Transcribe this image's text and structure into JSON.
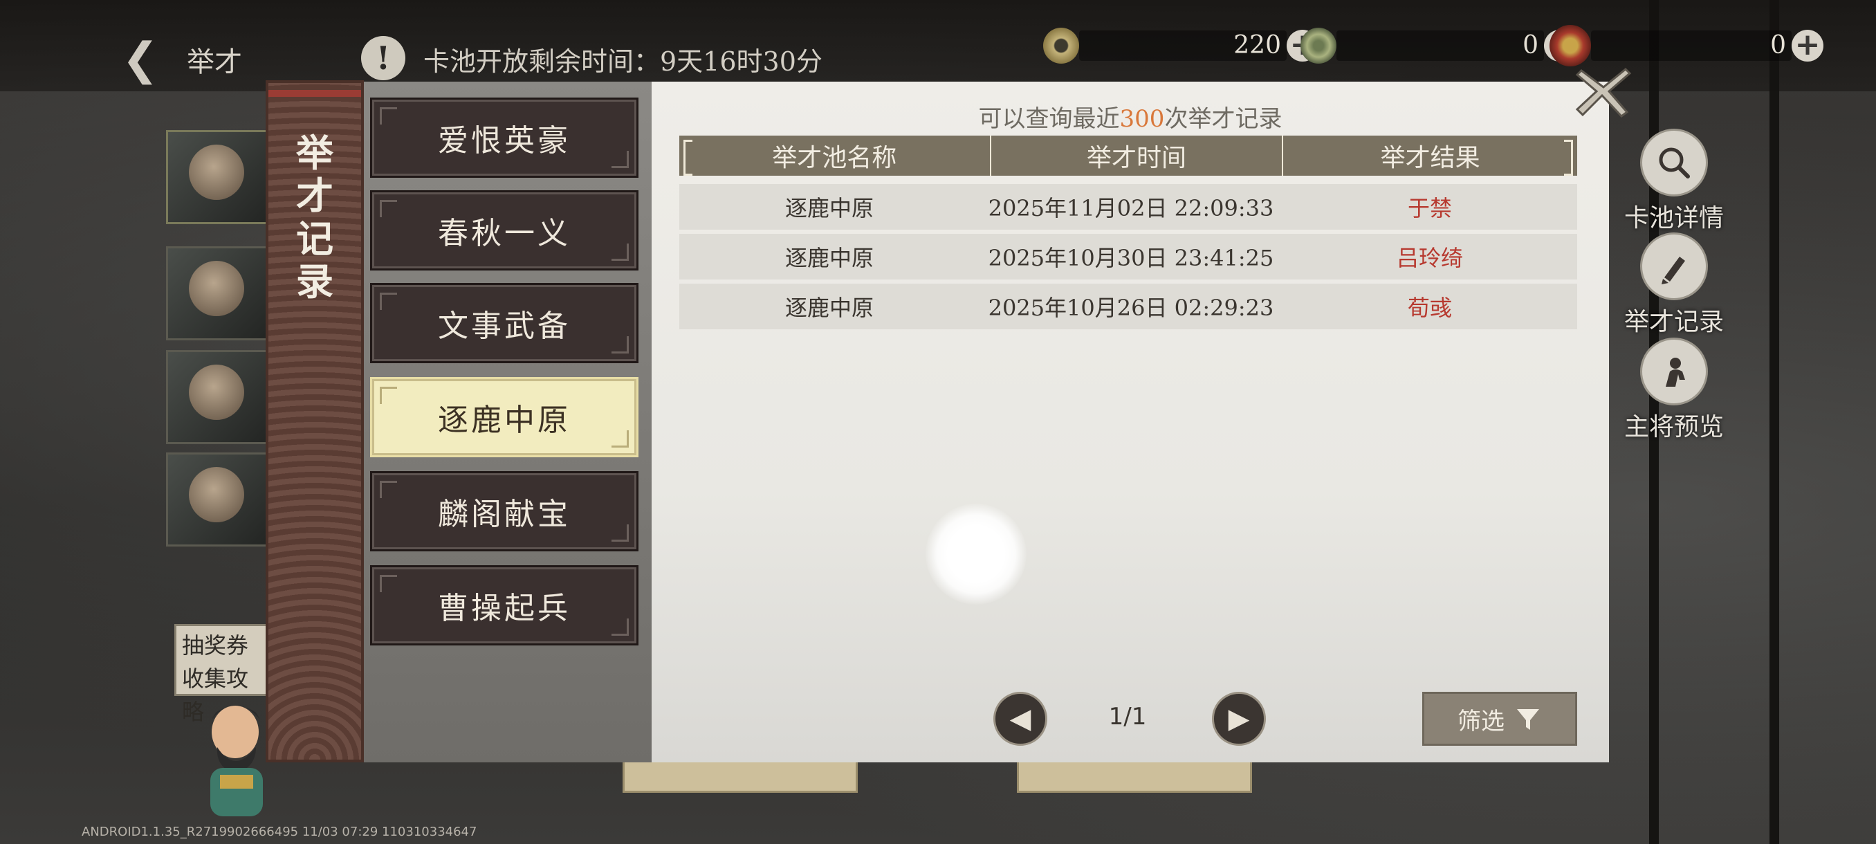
{
  "header": {
    "back_label": "举才",
    "timer_text": "卡池开放剩余时间：9天16时30分"
  },
  "currencies": [
    {
      "icon": "coin-icon",
      "value": "220"
    },
    {
      "icon": "jade-icon",
      "value": "0"
    },
    {
      "icon": "gem-icon",
      "value": "0"
    }
  ],
  "left": {
    "lottery_note": "抽奖券收集攻略"
  },
  "side_buttons": [
    {
      "icon": "magnifier-icon",
      "label": "卡池详情"
    },
    {
      "icon": "brush-icon",
      "label": "举才记录"
    },
    {
      "icon": "general-icon",
      "label": "主将预览"
    }
  ],
  "panel": {
    "vertical_title": "举才记录",
    "tabs": [
      "爱恨英豪",
      "春秋一义",
      "文事武备",
      "逐鹿中原",
      "麟阁献宝",
      "曹操起兵"
    ],
    "active_tab": "逐鹿中原",
    "subtitle_pre": "可以查询最近",
    "subtitle_num": "300",
    "subtitle_post": "次举才记录",
    "columns": [
      "举才池名称",
      "举才时间",
      "举才结果"
    ],
    "rows": [
      {
        "pool": "逐鹿中原",
        "time": "2025年11月02日  22:09:33",
        "result": "于禁"
      },
      {
        "pool": "逐鹿中原",
        "time": "2025年10月30日  23:41:25",
        "result": "吕玲绮"
      },
      {
        "pool": "逐鹿中原",
        "time": "2025年10月26日  02:29:23",
        "result": "荀彧"
      }
    ],
    "page": "1/1",
    "filter_label": "筛选"
  },
  "footer": {
    "version": "ANDROID1.1.35_R2719902666495 11/03 07:29 110310334647"
  }
}
